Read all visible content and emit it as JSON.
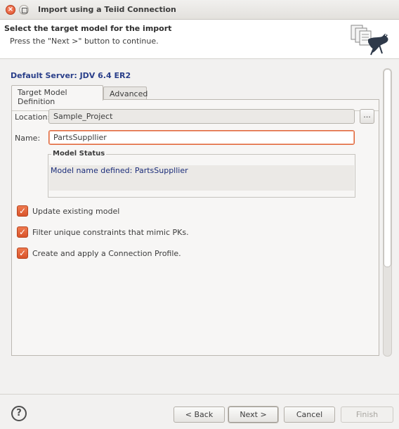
{
  "window": {
    "title": "Import using a Teiid Connection"
  },
  "banner": {
    "title": "Select the target model for the import",
    "description": "Press the \"Next >\" button to continue.",
    "icon": "import-wizard-icon"
  },
  "server_label": "Default Server: JDV 6.4 ER2",
  "tabs": [
    {
      "label": "Target Model Definition",
      "active": true
    },
    {
      "label": "Advanced",
      "active": false
    }
  ],
  "form": {
    "location_label": "Location:",
    "location_value": "Sample_Project",
    "browse_label": "...",
    "name_label": "Name:",
    "name_value": "PartsSuppllier"
  },
  "model_status": {
    "title": "Model Status",
    "message": "Model name defined: PartsSuppllier"
  },
  "options": [
    {
      "label": "Update existing model",
      "checked": true
    },
    {
      "label": "Filter unique constraints that mimic PKs.",
      "checked": true
    },
    {
      "label": "Create and apply a Connection Profile.",
      "checked": true
    }
  ],
  "buttons": {
    "help": "?",
    "back": "< Back",
    "next": "Next >",
    "cancel": "Cancel",
    "finish": "Finish"
  },
  "colors": {
    "accent": "#e0512a",
    "server_text": "#2a3f8a",
    "status_text": "#1b2d7a"
  }
}
